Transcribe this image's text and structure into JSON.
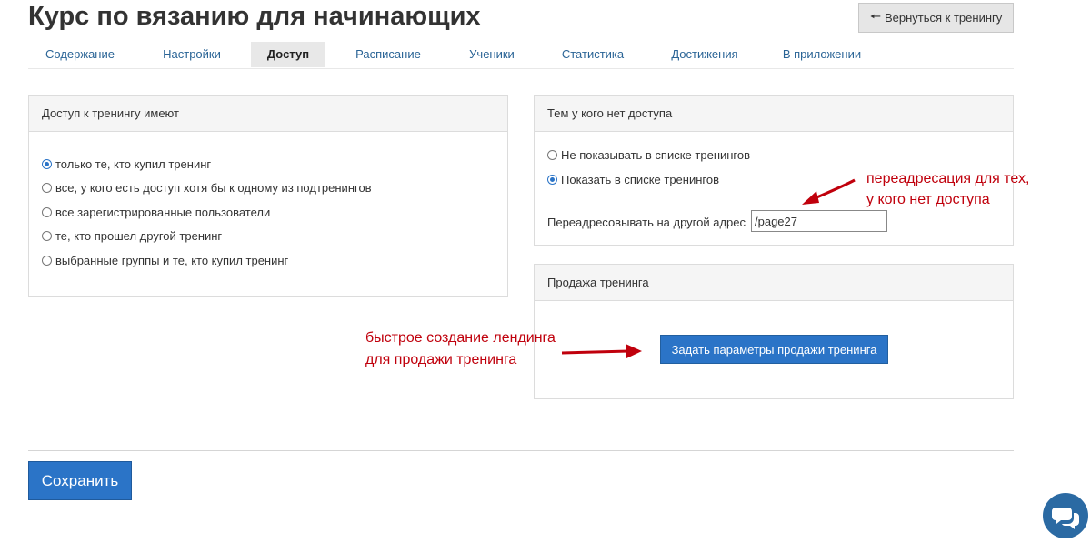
{
  "header": {
    "title": "Курс по вязанию для начинающих",
    "back_button_label": "Вернуться к тренингу"
  },
  "tabs": [
    {
      "label": "Содержание",
      "active": false
    },
    {
      "label": "Настройки",
      "active": false
    },
    {
      "label": "Доступ",
      "active": true
    },
    {
      "label": "Расписание",
      "active": false
    },
    {
      "label": "Ученики",
      "active": false
    },
    {
      "label": "Статистика",
      "active": false
    },
    {
      "label": "Достижения",
      "active": false
    },
    {
      "label": "В приложении",
      "active": false
    }
  ],
  "access_panel": {
    "title": "Доступ к тренингу имеют",
    "options": [
      {
        "label": "только те, кто купил тренинг",
        "checked": true
      },
      {
        "label": "все, у кого есть доступ хотя бы к одному из подтренингов",
        "checked": false
      },
      {
        "label": "все зарегистрированные пользователи",
        "checked": false
      },
      {
        "label": "те, кто прошел другой тренинг",
        "checked": false
      },
      {
        "label": "выбранные группы и те, кто купил тренинг",
        "checked": false
      }
    ]
  },
  "no_access_panel": {
    "title": "Тем у кого нет доступа",
    "options": [
      {
        "label": "Не показывать в списке тренингов",
        "checked": false
      },
      {
        "label": "Показать в списке тренингов",
        "checked": true
      }
    ],
    "redirect_label": "Переадресовывать на другой адрес",
    "redirect_value": "/page27"
  },
  "sale_panel": {
    "title": "Продажа тренинга",
    "button_label": "Задать параметры продажи тренинга"
  },
  "annotations": {
    "redirect_note_line1": "переадресация для тех,",
    "redirect_note_line2": "у кого нет доступа",
    "landing_note_line1": "быстрое создание лендинга",
    "landing_note_line2": "для продажи тренинга",
    "color": "#c0000c"
  },
  "footer": {
    "save_label": "Сохранить"
  },
  "icons": {
    "back": "arrow-left-icon",
    "chat": "chat-bubbles-icon"
  },
  "colors": {
    "primary": "#2b74c7",
    "link": "#2a6496",
    "chat": "#2b6aa3"
  }
}
